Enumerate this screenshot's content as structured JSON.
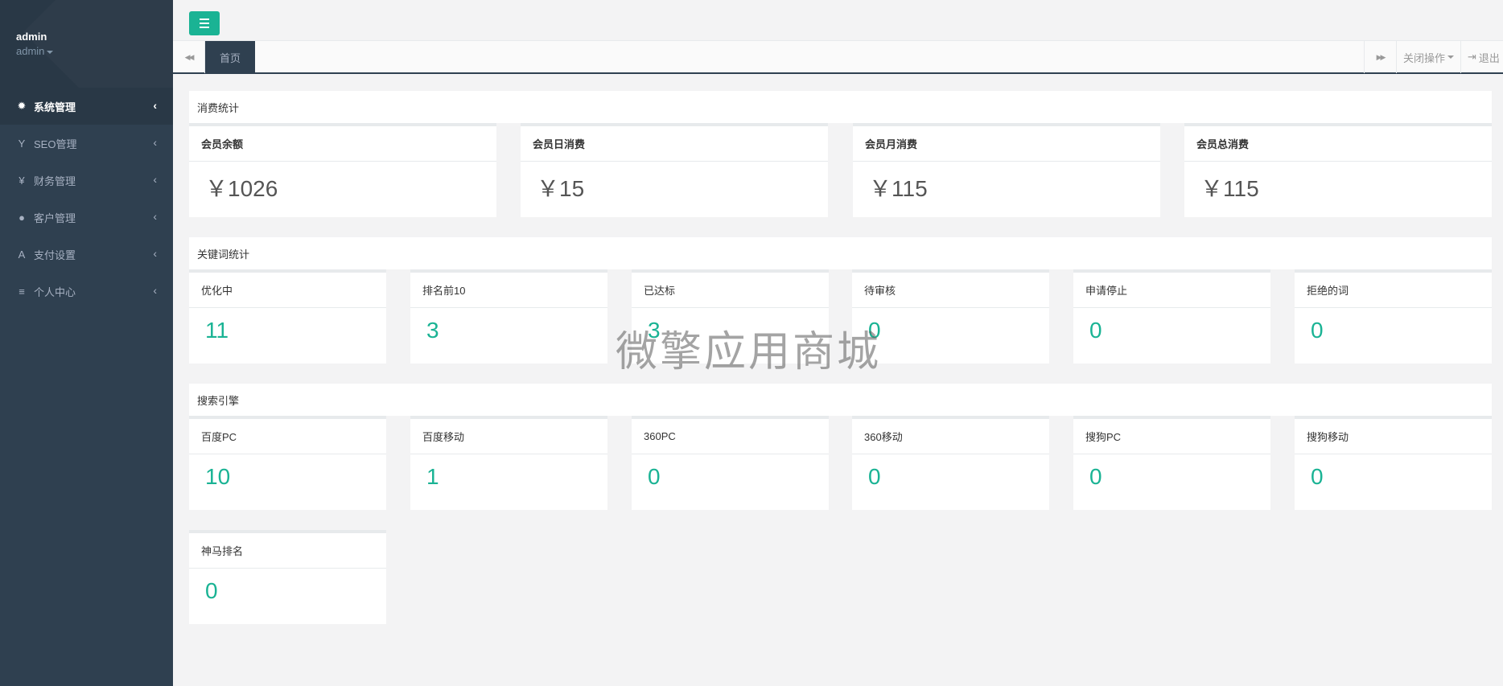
{
  "user": {
    "name": "admin",
    "role": "admin"
  },
  "sidebar": {
    "items": [
      {
        "label": "系统管理",
        "icon": "gear-icon",
        "glyph": "✹",
        "active": true
      },
      {
        "label": "SEO管理",
        "icon": "filter-icon",
        "glyph": "Y"
      },
      {
        "label": "财务管理",
        "icon": "yen-icon",
        "glyph": "¥"
      },
      {
        "label": "客户管理",
        "icon": "user-icon",
        "glyph": "●"
      },
      {
        "label": "支付设置",
        "icon": "font-icon",
        "glyph": "A"
      },
      {
        "label": "个人中心",
        "icon": "list-icon",
        "glyph": "≡"
      }
    ]
  },
  "tabs": {
    "active": "首页",
    "nav_left_glyph": "◀◀",
    "nav_right_glyph": "▶▶",
    "close_ops": "关闭操作",
    "logout": "退出"
  },
  "consumption": {
    "title": "消费统计",
    "cards": [
      {
        "label": "会员余额",
        "value": "￥1026"
      },
      {
        "label": "会员日消费",
        "value": "￥15"
      },
      {
        "label": "会员月消费",
        "value": "￥115"
      },
      {
        "label": "会员总消费",
        "value": "￥115"
      }
    ]
  },
  "keywords": {
    "title": "关键词统计",
    "cards": [
      {
        "label": "优化中",
        "value": "11"
      },
      {
        "label": "排名前10",
        "value": "3"
      },
      {
        "label": "已达标",
        "value": "3"
      },
      {
        "label": "待审核",
        "value": "0"
      },
      {
        "label": "申请停止",
        "value": "0"
      },
      {
        "label": "拒绝的词",
        "value": "0"
      }
    ]
  },
  "engines": {
    "title": "搜索引擎",
    "cards": [
      {
        "label": "百度PC",
        "value": "10"
      },
      {
        "label": "百度移动",
        "value": "1"
      },
      {
        "label": "360PC",
        "value": "0"
      },
      {
        "label": "360移动",
        "value": "0"
      },
      {
        "label": "搜狗PC",
        "value": "0"
      },
      {
        "label": "搜狗移动",
        "value": "0"
      },
      {
        "label": "神马排名",
        "value": "0"
      }
    ]
  },
  "watermark": "微擎应用商城",
  "colors": {
    "sidebar": "#2f4050",
    "accent": "#1ab394",
    "background": "#f3f3f4"
  }
}
